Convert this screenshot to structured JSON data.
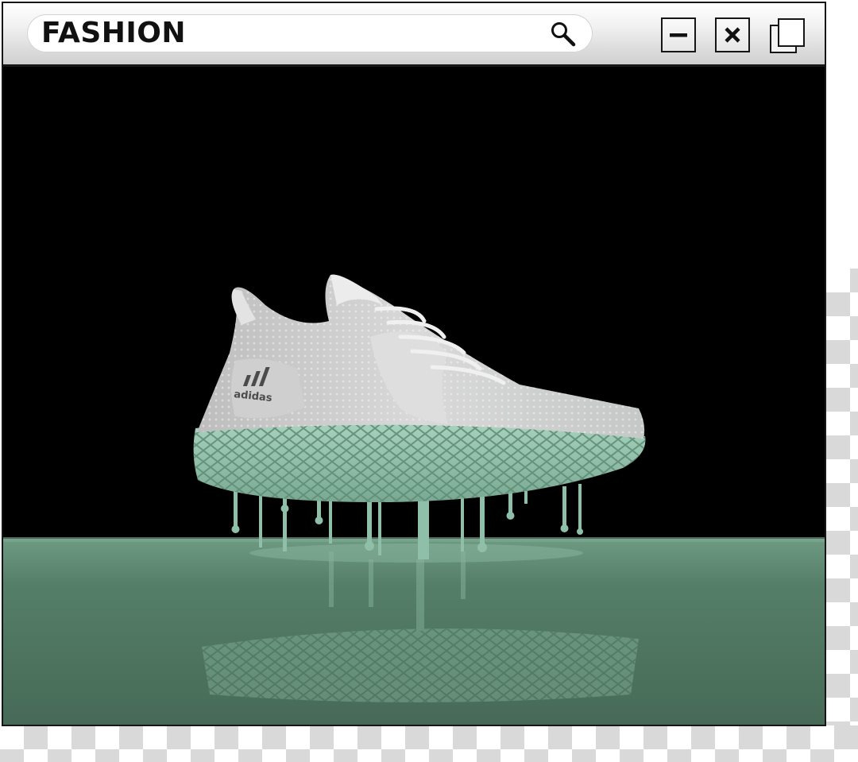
{
  "window": {
    "search_text": "FASHION"
  },
  "icons": {
    "search": "magnifier-icon",
    "minimize": "minimize-icon",
    "close": "close-icon",
    "restore": "restore-icon"
  },
  "photo": {
    "brand_text": "adidas"
  },
  "colors": {
    "floor": "#5f8b72",
    "sole": "#86b8a0",
    "background": "#000000"
  }
}
